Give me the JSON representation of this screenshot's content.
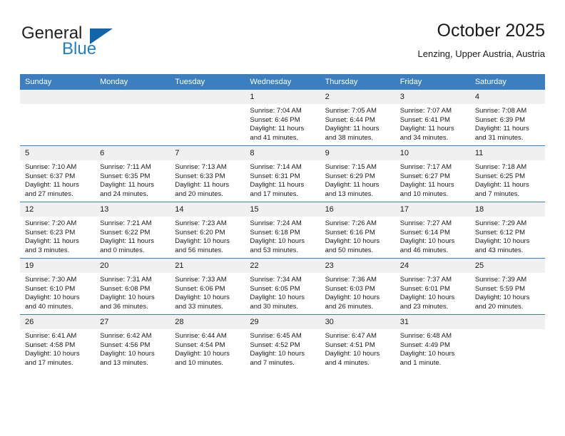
{
  "brand": {
    "name_top": "General",
    "name_bottom": "Blue",
    "triangle_color": "#1165a8",
    "blue_color": "#1f7fc4"
  },
  "header": {
    "title": "October 2025",
    "subtitle": "Lenzing, Upper Austria, Austria"
  },
  "theme": {
    "header_bg": "#3c7fc0",
    "daynum_bg": "#f0f0f0",
    "row_divider": "#3c7fc0"
  },
  "weekdays": [
    "Sunday",
    "Monday",
    "Tuesday",
    "Wednesday",
    "Thursday",
    "Friday",
    "Saturday"
  ],
  "labels": {
    "sunrise_prefix": "Sunrise: ",
    "sunset_prefix": "Sunset: ",
    "daylight_prefix": "Daylight: "
  },
  "weeks": [
    [
      {
        "day": "",
        "blank": true
      },
      {
        "day": "",
        "blank": true
      },
      {
        "day": "",
        "blank": true
      },
      {
        "day": "1",
        "sunrise": "Sunrise: 7:04 AM",
        "sunset": "Sunset: 6:46 PM",
        "daylight_line1": "Daylight: 11 hours",
        "daylight_line2": "and 41 minutes."
      },
      {
        "day": "2",
        "sunrise": "Sunrise: 7:05 AM",
        "sunset": "Sunset: 6:44 PM",
        "daylight_line1": "Daylight: 11 hours",
        "daylight_line2": "and 38 minutes."
      },
      {
        "day": "3",
        "sunrise": "Sunrise: 7:07 AM",
        "sunset": "Sunset: 6:41 PM",
        "daylight_line1": "Daylight: 11 hours",
        "daylight_line2": "and 34 minutes."
      },
      {
        "day": "4",
        "sunrise": "Sunrise: 7:08 AM",
        "sunset": "Sunset: 6:39 PM",
        "daylight_line1": "Daylight: 11 hours",
        "daylight_line2": "and 31 minutes."
      }
    ],
    [
      {
        "day": "5",
        "sunrise": "Sunrise: 7:10 AM",
        "sunset": "Sunset: 6:37 PM",
        "daylight_line1": "Daylight: 11 hours",
        "daylight_line2": "and 27 minutes."
      },
      {
        "day": "6",
        "sunrise": "Sunrise: 7:11 AM",
        "sunset": "Sunset: 6:35 PM",
        "daylight_line1": "Daylight: 11 hours",
        "daylight_line2": "and 24 minutes."
      },
      {
        "day": "7",
        "sunrise": "Sunrise: 7:13 AM",
        "sunset": "Sunset: 6:33 PM",
        "daylight_line1": "Daylight: 11 hours",
        "daylight_line2": "and 20 minutes."
      },
      {
        "day": "8",
        "sunrise": "Sunrise: 7:14 AM",
        "sunset": "Sunset: 6:31 PM",
        "daylight_line1": "Daylight: 11 hours",
        "daylight_line2": "and 17 minutes."
      },
      {
        "day": "9",
        "sunrise": "Sunrise: 7:15 AM",
        "sunset": "Sunset: 6:29 PM",
        "daylight_line1": "Daylight: 11 hours",
        "daylight_line2": "and 13 minutes."
      },
      {
        "day": "10",
        "sunrise": "Sunrise: 7:17 AM",
        "sunset": "Sunset: 6:27 PM",
        "daylight_line1": "Daylight: 11 hours",
        "daylight_line2": "and 10 minutes."
      },
      {
        "day": "11",
        "sunrise": "Sunrise: 7:18 AM",
        "sunset": "Sunset: 6:25 PM",
        "daylight_line1": "Daylight: 11 hours",
        "daylight_line2": "and 7 minutes."
      }
    ],
    [
      {
        "day": "12",
        "sunrise": "Sunrise: 7:20 AM",
        "sunset": "Sunset: 6:23 PM",
        "daylight_line1": "Daylight: 11 hours",
        "daylight_line2": "and 3 minutes."
      },
      {
        "day": "13",
        "sunrise": "Sunrise: 7:21 AM",
        "sunset": "Sunset: 6:22 PM",
        "daylight_line1": "Daylight: 11 hours",
        "daylight_line2": "and 0 minutes."
      },
      {
        "day": "14",
        "sunrise": "Sunrise: 7:23 AM",
        "sunset": "Sunset: 6:20 PM",
        "daylight_line1": "Daylight: 10 hours",
        "daylight_line2": "and 56 minutes."
      },
      {
        "day": "15",
        "sunrise": "Sunrise: 7:24 AM",
        "sunset": "Sunset: 6:18 PM",
        "daylight_line1": "Daylight: 10 hours",
        "daylight_line2": "and 53 minutes."
      },
      {
        "day": "16",
        "sunrise": "Sunrise: 7:26 AM",
        "sunset": "Sunset: 6:16 PM",
        "daylight_line1": "Daylight: 10 hours",
        "daylight_line2": "and 50 minutes."
      },
      {
        "day": "17",
        "sunrise": "Sunrise: 7:27 AM",
        "sunset": "Sunset: 6:14 PM",
        "daylight_line1": "Daylight: 10 hours",
        "daylight_line2": "and 46 minutes."
      },
      {
        "day": "18",
        "sunrise": "Sunrise: 7:29 AM",
        "sunset": "Sunset: 6:12 PM",
        "daylight_line1": "Daylight: 10 hours",
        "daylight_line2": "and 43 minutes."
      }
    ],
    [
      {
        "day": "19",
        "sunrise": "Sunrise: 7:30 AM",
        "sunset": "Sunset: 6:10 PM",
        "daylight_line1": "Daylight: 10 hours",
        "daylight_line2": "and 40 minutes."
      },
      {
        "day": "20",
        "sunrise": "Sunrise: 7:31 AM",
        "sunset": "Sunset: 6:08 PM",
        "daylight_line1": "Daylight: 10 hours",
        "daylight_line2": "and 36 minutes."
      },
      {
        "day": "21",
        "sunrise": "Sunrise: 7:33 AM",
        "sunset": "Sunset: 6:06 PM",
        "daylight_line1": "Daylight: 10 hours",
        "daylight_line2": "and 33 minutes."
      },
      {
        "day": "22",
        "sunrise": "Sunrise: 7:34 AM",
        "sunset": "Sunset: 6:05 PM",
        "daylight_line1": "Daylight: 10 hours",
        "daylight_line2": "and 30 minutes."
      },
      {
        "day": "23",
        "sunrise": "Sunrise: 7:36 AM",
        "sunset": "Sunset: 6:03 PM",
        "daylight_line1": "Daylight: 10 hours",
        "daylight_line2": "and 26 minutes."
      },
      {
        "day": "24",
        "sunrise": "Sunrise: 7:37 AM",
        "sunset": "Sunset: 6:01 PM",
        "daylight_line1": "Daylight: 10 hours",
        "daylight_line2": "and 23 minutes."
      },
      {
        "day": "25",
        "sunrise": "Sunrise: 7:39 AM",
        "sunset": "Sunset: 5:59 PM",
        "daylight_line1": "Daylight: 10 hours",
        "daylight_line2": "and 20 minutes."
      }
    ],
    [
      {
        "day": "26",
        "sunrise": "Sunrise: 6:41 AM",
        "sunset": "Sunset: 4:58 PM",
        "daylight_line1": "Daylight: 10 hours",
        "daylight_line2": "and 17 minutes."
      },
      {
        "day": "27",
        "sunrise": "Sunrise: 6:42 AM",
        "sunset": "Sunset: 4:56 PM",
        "daylight_line1": "Daylight: 10 hours",
        "daylight_line2": "and 13 minutes."
      },
      {
        "day": "28",
        "sunrise": "Sunrise: 6:44 AM",
        "sunset": "Sunset: 4:54 PM",
        "daylight_line1": "Daylight: 10 hours",
        "daylight_line2": "and 10 minutes."
      },
      {
        "day": "29",
        "sunrise": "Sunrise: 6:45 AM",
        "sunset": "Sunset: 4:52 PM",
        "daylight_line1": "Daylight: 10 hours",
        "daylight_line2": "and 7 minutes."
      },
      {
        "day": "30",
        "sunrise": "Sunrise: 6:47 AM",
        "sunset": "Sunset: 4:51 PM",
        "daylight_line1": "Daylight: 10 hours",
        "daylight_line2": "and 4 minutes."
      },
      {
        "day": "31",
        "sunrise": "Sunrise: 6:48 AM",
        "sunset": "Sunset: 4:49 PM",
        "daylight_line1": "Daylight: 10 hours",
        "daylight_line2": "and 1 minute."
      },
      {
        "day": "",
        "blank": true
      }
    ]
  ]
}
